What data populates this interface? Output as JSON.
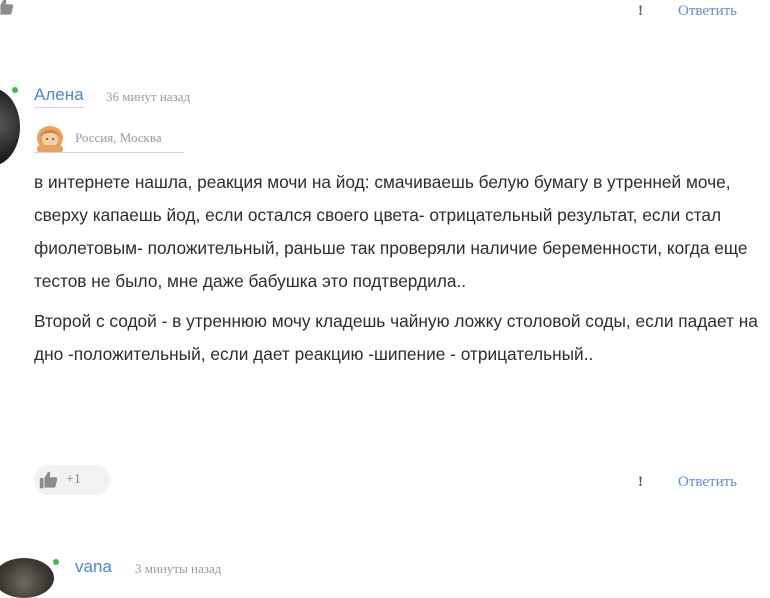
{
  "top_comment": {
    "report_label": "!",
    "reply_label": "Ответить"
  },
  "comment": {
    "username": "Алена",
    "time": "36 минут назад",
    "location": "Россия, Москва",
    "paragraphs": [
      "в интернете нашла, реакция мочи на йод: смачиваешь белую бумагу в утренней моче, сверху капаешь йод, если остался своего цвета- отрицательный результат, если стал фиолетовым- положительный, раньше так проверяли наличие беременности, когда еще тестов не было, мне даже бабушка это подтвердила..",
      "Второй с содой - в утреннюю мочу кладешь чайную ложку столовой соды, если падает на дно -положительный, если дает реакцию -шипение - отрицательный.."
    ],
    "likes": "+1",
    "report_label": "!",
    "reply_label": "Ответить"
  },
  "next_comment": {
    "username": "vana",
    "time": "3 минуты назад"
  },
  "colors": {
    "link": "#4c87c9",
    "online": "#3dbb4e",
    "muted": "#9a9a9a"
  }
}
